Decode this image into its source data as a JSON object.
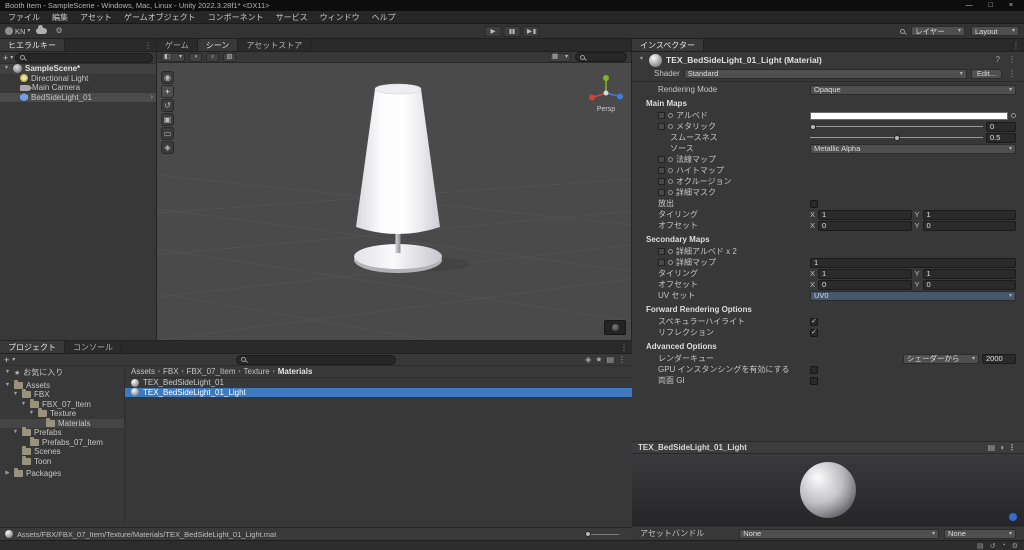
{
  "window": {
    "title": "Booth Item - SampleScene - Windows, Mac, Linux - Unity 2022.3.28f1* <DX11>"
  },
  "menu": {
    "items": [
      "ファイル",
      "編集",
      "アセット",
      "ゲームオブジェクト",
      "コンポーネント",
      "サービス",
      "ウィンドウ",
      "ヘルプ"
    ]
  },
  "toolbar": {
    "account": "KN",
    "layers": "レイヤー",
    "layout": "Layout"
  },
  "hierarchy": {
    "tab": "ヒエラルキー",
    "scene_name": "SampleScene*",
    "items": [
      {
        "label": "Directional Light"
      },
      {
        "label": "Main Camera"
      },
      {
        "label": "BedSideLight_01"
      }
    ]
  },
  "scene": {
    "tab_game": "ゲーム",
    "tab_scene": "シーン",
    "tab_store": "アセットストア",
    "persp": "Persp"
  },
  "inspector": {
    "tab": "インスペクター",
    "material_name": "TEX_BedSideLight_01_Light (Material)",
    "shader_label": "Shader",
    "shader_value": "Standard",
    "edit_button": "Edit...",
    "rendering_mode_label": "Rendering Mode",
    "rendering_mode_value": "Opaque",
    "main_maps_title": "Main Maps",
    "albedo_label": "アルベド",
    "metallic_label": "メタリック",
    "metallic_value": "0",
    "smoothness_label": "スムースネス",
    "smoothness_value": "0.5",
    "source_label": "ソース",
    "source_value": "Metallic Alpha",
    "normal_map_label": "法線マップ",
    "height_map_label": "ハイトマップ",
    "occlusion_label": "オクルージョン",
    "detail_mask_label": "詳細マスク",
    "emission_label": "放出",
    "tiling_label": "タイリング",
    "offset_label": "オフセット",
    "x_label": "X",
    "y_label": "Y",
    "main_tiling_x": "1",
    "main_tiling_y": "1",
    "main_offset_x": "0",
    "main_offset_y": "0",
    "secondary_maps_title": "Secondary Maps",
    "detail_albedo_label": "詳細アルベド x 2",
    "detail_normal_label": "詳細マップ",
    "detail_normal_value": "1",
    "sec_tiling_x": "1",
    "sec_tiling_y": "1",
    "sec_offset_x": "0",
    "sec_offset_y": "0",
    "uv_set_label": "UV セット",
    "uv_set_value": "UV0",
    "forward_title": "Forward Rendering Options",
    "specular_label": "スペキュラーハイライト",
    "reflections_label": "リフレクション",
    "advanced_title": "Advanced Options",
    "render_queue_label": "レンダーキュー",
    "render_queue_value": "シェーダーから",
    "render_queue_number": "2000",
    "gpu_instancing_label": "GPU インスタンシングを有効にする",
    "double_gi_label": "両面 GI",
    "preview_title": "TEX_BedSideLight_01_Light",
    "asset_bundle_label": "アセットバンドル",
    "asset_bundle_none1": "None",
    "asset_bundle_none2": "None"
  },
  "project": {
    "tab_project": "プロジェクト",
    "tab_console": "コンソール",
    "tree": [
      {
        "label": "お気に入り"
      },
      {
        "label": "Assets"
      },
      {
        "label": "FBX"
      },
      {
        "label": "FBX_07_Item"
      },
      {
        "label": "Texture"
      },
      {
        "label": "Materials"
      },
      {
        "label": "Prefabs"
      },
      {
        "label": "Prefabs_07_Item"
      },
      {
        "label": "Scenes"
      },
      {
        "label": "Toon"
      },
      {
        "label": "Packages"
      }
    ],
    "breadcrumb": [
      "Assets",
      "FBX",
      "FBX_07_Item",
      "Texture",
      "Materials"
    ],
    "files": [
      {
        "name": "TEX_BedSideLight_01"
      },
      {
        "name": "TEX_BedSideLight_01_Light"
      }
    ],
    "status_path": "Assets/FBX/FBX_07_Item/Texture/Materials/TEX_BedSideLight_01_Light.mat"
  },
  "icons": {
    "caret": "▾",
    "fold_open": "▼",
    "fold_closed": "▶",
    "more": "⋮",
    "check": "✓",
    "help": "?",
    "close": "×",
    "minimize": "—",
    "maximize": "□",
    "plus": "+",
    "play": "▶",
    "crumb_sep": "›",
    "chevron": "›",
    "star": "★",
    "gear": "⚙",
    "grid": "▦",
    "shading": "◧",
    "half_circle": "◑",
    "note": "♪",
    "fx": "▨",
    "tool_view": "◉",
    "tool_move": "+",
    "tool_rotate": "↺",
    "tool_scale": "▣",
    "tool_rect": "▭",
    "tool_transform": "◈",
    "quarter": "◔",
    "panel": "▤"
  }
}
